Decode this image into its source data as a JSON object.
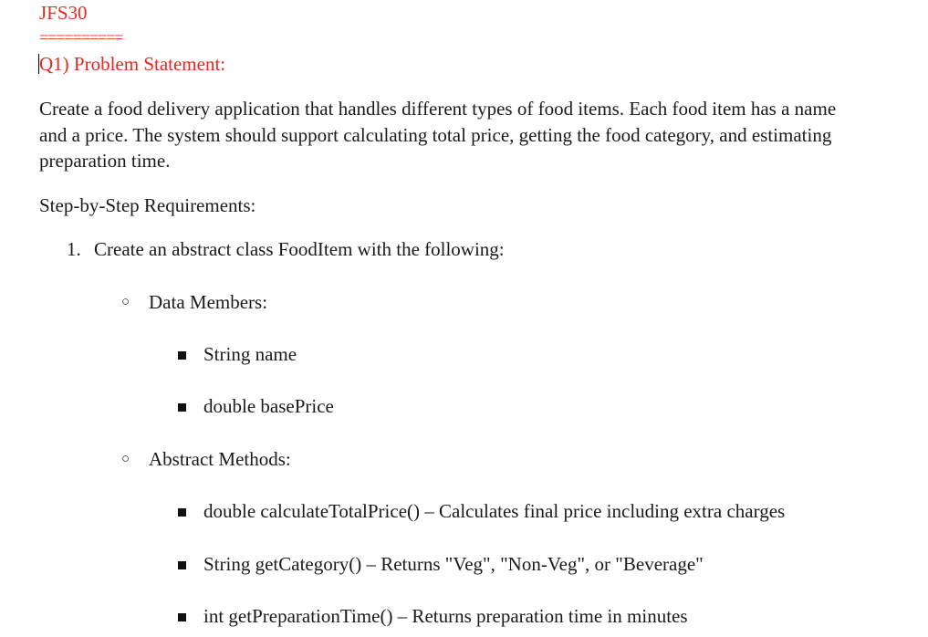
{
  "header": {
    "code": "JFS30",
    "divider": "==========",
    "question_title": "Q1) Problem Statement:"
  },
  "problem": {
    "paragraph": "Create a food delivery application that handles different types of food items. Each food item has a name and a price. The system should support calculating total price, getting the food category, and estimating preparation time."
  },
  "requirements": {
    "heading": "Step-by-Step Requirements:",
    "item1": {
      "number": "1.",
      "text": "Create an abstract class FoodItem with the following:",
      "data_members": {
        "label": "Data Members:",
        "items": [
          "String name",
          "double basePrice"
        ]
      },
      "abstract_methods": {
        "label": "Abstract Methods:",
        "items": [
          "double calculateTotalPrice() – Calculates final price including extra charges",
          "String getCategory() – Returns \"Veg\", \"Non-Veg\", or \"Beverage\"",
          "int getPreparationTime() – Returns preparation time in minutes"
        ]
      }
    }
  },
  "colors": {
    "accent_red": "#e8281e",
    "text": "#1a1a1a"
  }
}
